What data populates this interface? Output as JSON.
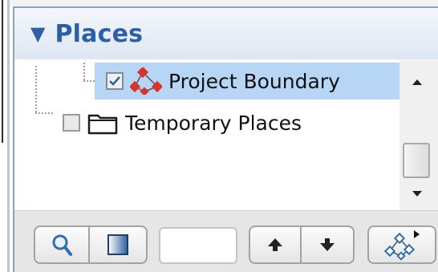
{
  "panel": {
    "title": "Places",
    "collapse_icon": "triangle-down-icon"
  },
  "tree": {
    "items": [
      {
        "label": "Project Boundary",
        "checked": true,
        "selected": true,
        "icon": "polygon-vertices-icon"
      },
      {
        "label": "Temporary Places",
        "checked": false,
        "selected": false,
        "icon": "folder-icon"
      }
    ]
  },
  "scrollbar": {
    "up_icon": "scroll-up-arrow-icon",
    "down_icon": "scroll-down-arrow-icon"
  },
  "toolbar": {
    "search_icon": "magnifier-icon",
    "layer_icon": "gradient-panel-icon",
    "filter_value": "",
    "move_up_icon": "arrow-up-icon",
    "move_down_icon": "arrow-down-icon",
    "add_place_icon": "polygon-dropdown-icon"
  },
  "colors": {
    "accent": "#2b5fa8",
    "selection": "#b7d6f5",
    "header_border": "#8aa1bf",
    "polygon_vertex": "#d9332b"
  }
}
